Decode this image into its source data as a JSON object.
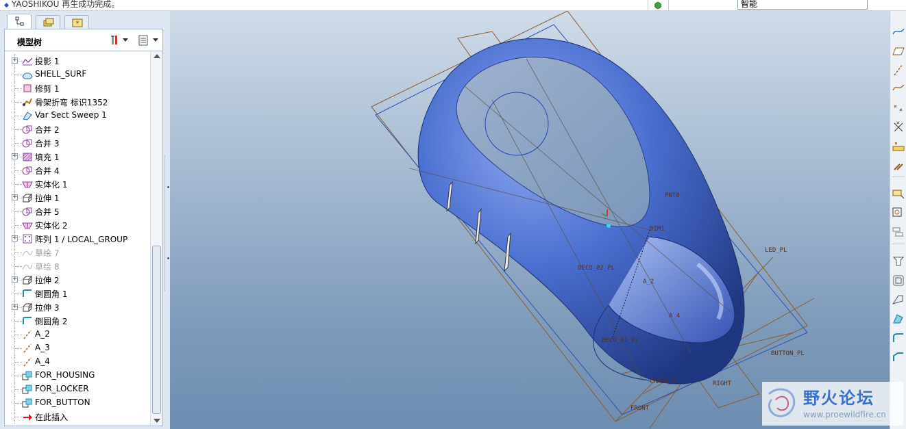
{
  "status": {
    "message": "YAOSHIKOU 再生成功完成。",
    "selection_filter": "智能",
    "regen_light_color": "#3fa33f"
  },
  "navigator": {
    "tabs": [
      {
        "name": "model-tree",
        "icon": "model-tree-icon"
      },
      {
        "name": "folder-browser",
        "icon": "folder-icon"
      },
      {
        "name": "favorites",
        "icon": "favorites-icon"
      }
    ],
    "title": "模型树",
    "tree_items": [
      {
        "label": "投影 1",
        "icon": "projection-icon",
        "expandable": true
      },
      {
        "label": "SHELL_SURF",
        "icon": "surface-icon",
        "expandable": false
      },
      {
        "label": "修剪 1",
        "icon": "trim-icon",
        "expandable": false
      },
      {
        "label": "骨架折弯 标识1352",
        "icon": "spinal-bend-icon",
        "expandable": false
      },
      {
        "label": "Var Sect Sweep 1",
        "icon": "sweep-icon",
        "expandable": false
      },
      {
        "label": "合并 2",
        "icon": "merge-icon",
        "expandable": false
      },
      {
        "label": "合并 3",
        "icon": "merge-icon",
        "expandable": false
      },
      {
        "label": "填充 1",
        "icon": "fill-icon",
        "expandable": true
      },
      {
        "label": "合并 4",
        "icon": "merge-icon",
        "expandable": false
      },
      {
        "label": "实体化 1",
        "icon": "solidify-icon",
        "expandable": false
      },
      {
        "label": "拉伸 1",
        "icon": "extrude-icon",
        "expandable": true
      },
      {
        "label": "合并 5",
        "icon": "merge-icon",
        "expandable": false
      },
      {
        "label": "实体化 2",
        "icon": "solidify-icon",
        "expandable": false
      },
      {
        "label": "阵列 1 / LOCAL_GROUP",
        "icon": "pattern-icon",
        "expandable": true
      },
      {
        "label": "草绘 7",
        "icon": "sketch-icon",
        "expandable": false,
        "suppressed": true
      },
      {
        "label": "草绘 8",
        "icon": "sketch-icon",
        "expandable": false,
        "suppressed": true
      },
      {
        "label": "拉伸 2",
        "icon": "extrude-icon",
        "expandable": true
      },
      {
        "label": "倒圆角 1",
        "icon": "round-icon",
        "expandable": false
      },
      {
        "label": "拉伸 3",
        "icon": "extrude-icon",
        "expandable": true
      },
      {
        "label": "倒圆角 2",
        "icon": "round-icon",
        "expandable": false
      },
      {
        "label": "A_2",
        "icon": "datum-axis-icon",
        "expandable": false
      },
      {
        "label": "A_3",
        "icon": "datum-axis-icon",
        "expandable": false
      },
      {
        "label": "A_4",
        "icon": "datum-axis-icon",
        "expandable": false
      },
      {
        "label": "FOR_HOUSING",
        "icon": "publish-geometry-icon",
        "expandable": false
      },
      {
        "label": "FOR_LOCKER",
        "icon": "publish-geometry-icon",
        "expandable": false
      },
      {
        "label": "FOR_BUTTON",
        "icon": "publish-geometry-icon",
        "expandable": false
      },
      {
        "label": "在此插入",
        "icon": "insert-here-icon",
        "expandable": false
      }
    ]
  },
  "viewport": {
    "model_color": "#3e63c4",
    "datum_color": "#8a5a2b",
    "datum_labels": {
      "pnt0": "PNT0",
      "dim1": "DIM1",
      "deco_02_pl": "DECO_02_PL",
      "a_2": "A_2",
      "a_4": "A_4",
      "deco_01_pl": "DECO_01_PL",
      "led_pl": "LED_PL",
      "button_pl": "BUTTON_PL",
      "chain_pl": "CHAIN_PL",
      "right": "RIGHT",
      "front": "FRONT"
    }
  },
  "right_toolbar": [
    "datum-curve-icon",
    "datum-plane-icon",
    "datum-axis-icon",
    "sketched-curve-icon",
    "datum-point-icon",
    "offset-point-icon",
    "point-field-icon",
    "coordinate-system-icon",
    "analysis-icon",
    "view-manager-icon",
    "layer-icon",
    "extrude-tool-icon",
    "revolve-tool-icon",
    "sweep-tool-icon",
    "blend-tool-icon",
    "round-tool-icon",
    "chamfer-tool-icon"
  ],
  "watermark": {
    "name": "野火论坛",
    "url": "www.proewildfire.cn"
  }
}
